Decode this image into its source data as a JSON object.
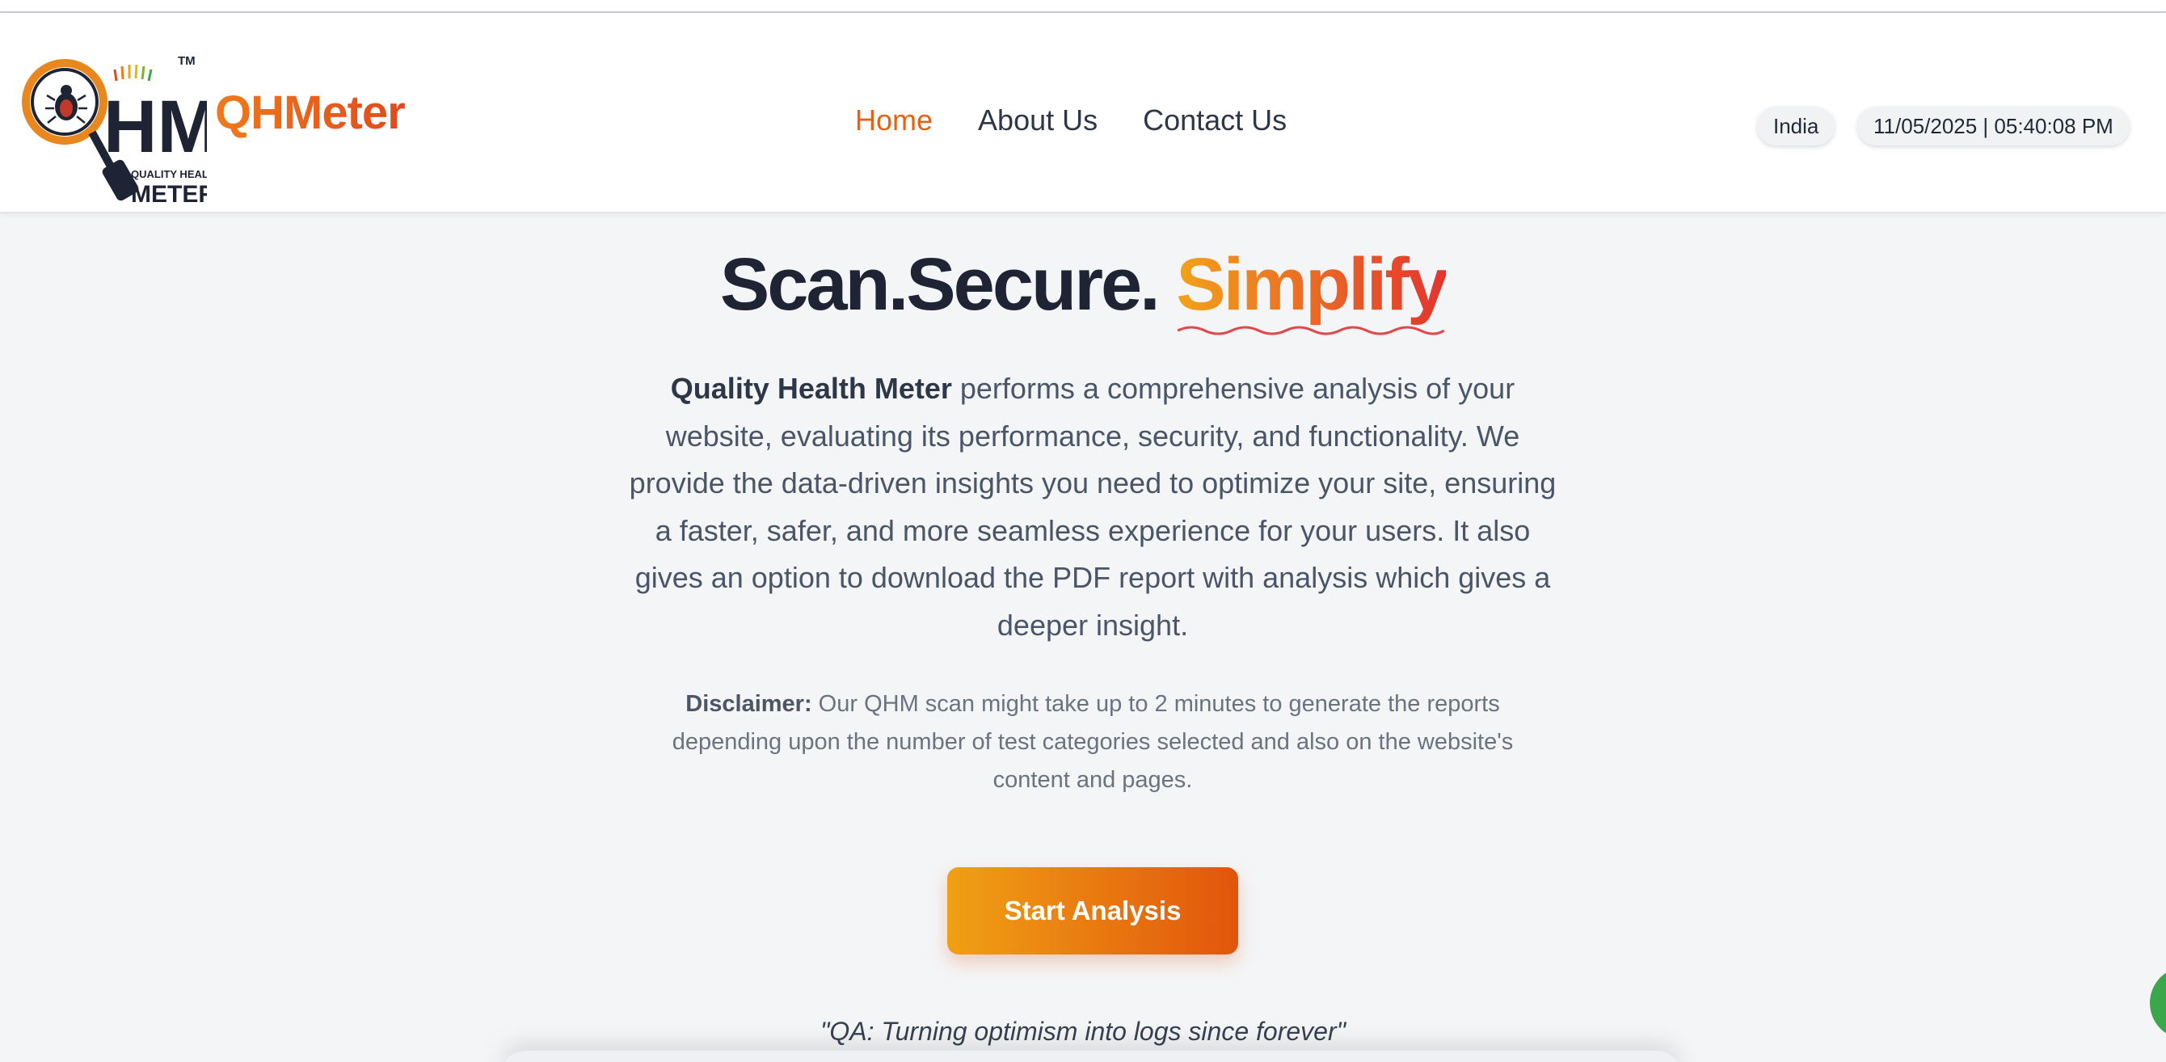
{
  "header": {
    "logo": {
      "letters": "HM",
      "tagline_top": "QUALITY HEALTH",
      "tagline_bottom": "METER",
      "trademark": "TM"
    },
    "brand_name": "QHMeter",
    "nav": [
      {
        "label": "Home",
        "active": true
      },
      {
        "label": "About Us",
        "active": false
      },
      {
        "label": "Contact Us",
        "active": false
      }
    ],
    "country": "India",
    "datetime": "11/05/2025 | 05:40:08 PM"
  },
  "hero": {
    "title_main": "Scan.Secure. ",
    "title_accent": "Simplify",
    "description_bold": "Quality Health Meter",
    "description_rest": " performs a comprehensive analysis of your website, evaluating its performance, security, and functionality. We provide the data-driven insights you need to optimize your site, ensuring a faster, safer, and more seamless experience for your users. It also gives an option to download the PDF report with analysis which gives a deeper insight.",
    "disclaimer_label": "Disclaimer:",
    "disclaimer_text": " Our QHM scan might take up to 2 minutes to generate the reports depending upon the number of test categories selected and also on the website's content and pages.",
    "cta_label": "Start Analysis",
    "quote": "\"QA: Turning optimism into logs since forever\""
  },
  "colors": {
    "accent_orange": "#e8610f",
    "gradient_start": "#f0a015",
    "gradient_end": "#e2550c",
    "accent_red": "#e3342f",
    "chat_green": "#3aa84a"
  },
  "icons": {
    "logo_icon": "magnifier-bug-icon",
    "chat_icon": "chat-bubble-icon"
  }
}
